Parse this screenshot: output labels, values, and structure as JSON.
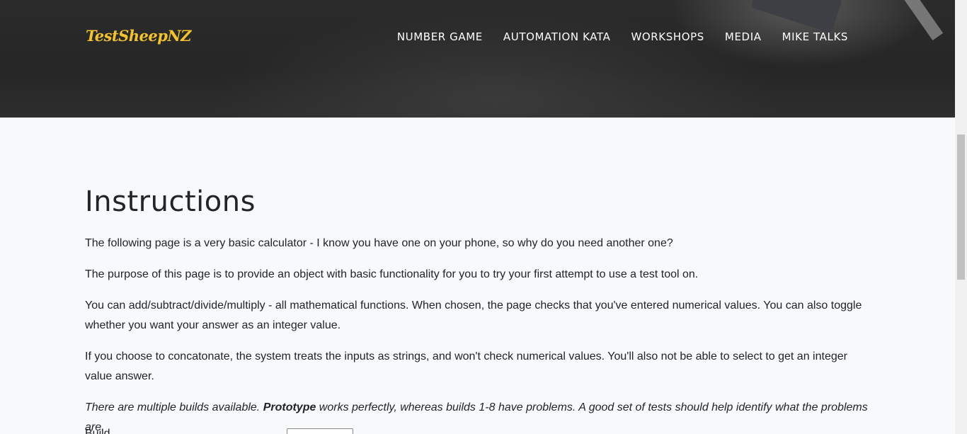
{
  "header": {
    "brand": "TestSheepNZ",
    "nav": [
      {
        "label": "NUMBER GAME"
      },
      {
        "label": "AUTOMATION KATA"
      },
      {
        "label": "WORKSHOPS"
      },
      {
        "label": "MEDIA"
      },
      {
        "label": "MIKE TALKS"
      }
    ]
  },
  "main": {
    "title": "Instructions",
    "paragraphs": [
      "The following page is a very basic calculator - I know you have one on your phone, so why do you need another one?",
      "The purpose of this page is to provide an object with basic functionality for you to try your first attempt to use a test tool on.",
      "You can add/subtract/divide/multiply - all mathematical functions. When chosen, the page checks that you've entered numerical values. You can also toggle whether you want your answer as an integer value.",
      "If you choose to concatonate, the system treats the inputs as strings, and won't check numerical values. You'll also not be able to select to get an integer value answer."
    ],
    "note": {
      "before": "There are multiple builds available. ",
      "bold": "Prototype",
      "after": " works perfectly, whereas builds 1-8 have problems. A good set of tests should help identify what the problems are."
    },
    "build_label": "Build"
  },
  "colors": {
    "brand": "#f2c230",
    "nav_text": "#ffffff",
    "page_bg": "#f7f9fb"
  }
}
